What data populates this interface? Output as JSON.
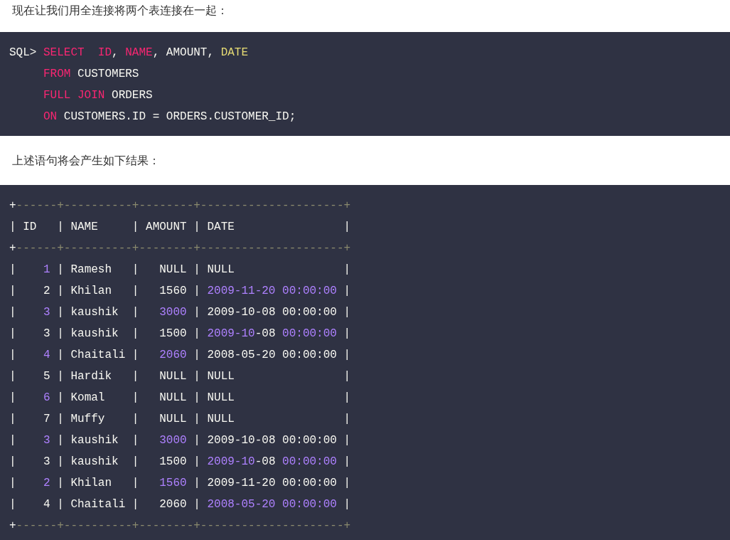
{
  "intro": "现在让我们用全连接将两个表连接在一起：",
  "query": [
    [
      {
        "text": "SQL> ",
        "kind": "plain"
      },
      {
        "text": "SELECT  ID",
        "kind": "keyword"
      },
      {
        "text": ", ",
        "kind": "plain"
      },
      {
        "text": "NAME",
        "kind": "keyword"
      },
      {
        "text": ", AMOUNT, ",
        "kind": "plain"
      },
      {
        "text": "DATE",
        "kind": "builtin"
      }
    ],
    [
      {
        "text": "     FROM",
        "kind": "keyword"
      },
      {
        "text": " CUSTOMERS",
        "kind": "plain"
      }
    ],
    [
      {
        "text": "     FULL JOIN",
        "kind": "keyword"
      },
      {
        "text": " ORDERS",
        "kind": "plain"
      }
    ],
    [
      {
        "text": "     ON",
        "kind": "keyword"
      },
      {
        "text": " CUSTOMERS.ID = ORDERS.CUSTOMER_ID;",
        "kind": "plain"
      }
    ]
  ],
  "result_caption": "上述语句将会产生如下结果：",
  "result": [
    [
      {
        "text": "+",
        "kind": "plain"
      },
      {
        "text": "------+----------+--------+---------------------+",
        "kind": "border"
      }
    ],
    [
      {
        "text": "| ID   | NAME     | AMOUNT | DATE                |",
        "kind": "plain"
      }
    ],
    [
      {
        "text": "+",
        "kind": "plain"
      },
      {
        "text": "------+----------+--------+---------------------+",
        "kind": "border"
      }
    ],
    [
      {
        "text": "|    ",
        "kind": "plain"
      },
      {
        "text": "1",
        "kind": "number"
      },
      {
        "text": " | Ramesh   |   NULL | NULL                |",
        "kind": "plain"
      }
    ],
    [
      {
        "text": "|    2 | Khilan   |   1560 | ",
        "kind": "plain"
      },
      {
        "text": "2009-11-20 00:00:00",
        "kind": "number"
      },
      {
        "text": " |",
        "kind": "plain"
      }
    ],
    [
      {
        "text": "|    ",
        "kind": "plain"
      },
      {
        "text": "3",
        "kind": "number"
      },
      {
        "text": " | kaushik  |   ",
        "kind": "plain"
      },
      {
        "text": "3000",
        "kind": "number"
      },
      {
        "text": " | 2009-10-08 00:00:00 |",
        "kind": "plain"
      }
    ],
    [
      {
        "text": "|    3 | kaushik  |   1500 | ",
        "kind": "plain"
      },
      {
        "text": "2009-10",
        "kind": "number"
      },
      {
        "text": "-08 ",
        "kind": "plain"
      },
      {
        "text": "00:00:00",
        "kind": "number"
      },
      {
        "text": " |",
        "kind": "plain"
      }
    ],
    [
      {
        "text": "|    ",
        "kind": "plain"
      },
      {
        "text": "4",
        "kind": "number"
      },
      {
        "text": " | Chaitali |   ",
        "kind": "plain"
      },
      {
        "text": "2060",
        "kind": "number"
      },
      {
        "text": " | 2008-05-20 00:00:00 |",
        "kind": "plain"
      }
    ],
    [
      {
        "text": "|    5 | Hardik   |   NULL | NULL                |",
        "kind": "plain"
      }
    ],
    [
      {
        "text": "|    ",
        "kind": "plain"
      },
      {
        "text": "6",
        "kind": "number"
      },
      {
        "text": " | Komal    |   NULL | NULL                |",
        "kind": "plain"
      }
    ],
    [
      {
        "text": "|    7 | Muffy    |   NULL | NULL                |",
        "kind": "plain"
      }
    ],
    [
      {
        "text": "|    ",
        "kind": "plain"
      },
      {
        "text": "3",
        "kind": "number"
      },
      {
        "text": " | kaushik  |   ",
        "kind": "plain"
      },
      {
        "text": "3000",
        "kind": "number"
      },
      {
        "text": " | 2009-10-08 00:00:00 |",
        "kind": "plain"
      }
    ],
    [
      {
        "text": "|    3 | kaushik  |   1500 | ",
        "kind": "plain"
      },
      {
        "text": "2009-10",
        "kind": "number"
      },
      {
        "text": "-08 ",
        "kind": "plain"
      },
      {
        "text": "00:00:00",
        "kind": "number"
      },
      {
        "text": " |",
        "kind": "plain"
      }
    ],
    [
      {
        "text": "|    ",
        "kind": "plain"
      },
      {
        "text": "2",
        "kind": "number"
      },
      {
        "text": " | Khilan   |   ",
        "kind": "plain"
      },
      {
        "text": "1560",
        "kind": "number"
      },
      {
        "text": " | 2009-11-20 00:00:00 |",
        "kind": "plain"
      }
    ],
    [
      {
        "text": "|    4 | Chaitali |   2060 | ",
        "kind": "plain"
      },
      {
        "text": "2008-05-20 00:00:00",
        "kind": "number"
      },
      {
        "text": " |",
        "kind": "plain"
      }
    ],
    [
      {
        "text": "+",
        "kind": "plain"
      },
      {
        "text": "------+----------+--------+---------------------+",
        "kind": "border"
      }
    ]
  ]
}
